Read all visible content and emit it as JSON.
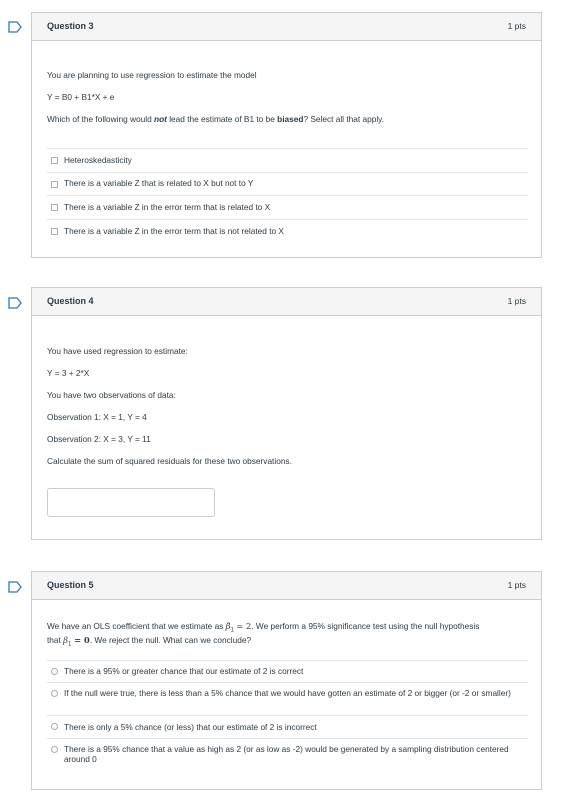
{
  "q3": {
    "title": "Question 3",
    "points": "1 pts",
    "intro": "You are planning to use regression to estimate the model",
    "model": "Y = B0 + B1*X + e",
    "prompt_a": "Which of the following would ",
    "prompt_not": "not",
    "prompt_b": " lead the estimate of B1 to be ",
    "prompt_biased": "biased",
    "prompt_c": "? Select all that apply.",
    "options": [
      "Heteroskedasticity",
      "There is a variable Z that is related to X but not to Y",
      "There is a variable Z in the error term that is related to X",
      "There is a variable Z in the error term that is not related to X"
    ]
  },
  "q4": {
    "title": "Question 4",
    "points": "1 pts",
    "line1": "You have used regression to estimate:",
    "line2": "Y = 3 + 2*X",
    "line3": "You have two observations of data:",
    "line4": "Observation 1: X = 1, Y = 4",
    "line5": "Observation 2: X = 3, Y = 11",
    "line6": "Calculate the sum of squared residuals for these two observations.",
    "answer_value": ""
  },
  "q5": {
    "title": "Question 5",
    "points": "1 pts",
    "line1a": "We have an OLS coefficient that we estimate as ",
    "beta_hat": "β̂",
    "sub1": "1",
    "eq_val": " = 2",
    "line1b": ". We perform a 95% significance test using the null hypothesis",
    "line2a": "that ",
    "beta": "β",
    "sub2": "1",
    "eq_zero": " = 0",
    "line2b": ". We reject the null. What can we conclude?",
    "options": [
      "There is a 95% or greater chance that our estimate of 2 is correct",
      "If the null were true, there is less than a 5% chance that we would have gotten an estimate of 2 or bigger (or -2 or smaller)",
      "There is only a 5% chance (or less) that our estimate of 2 is incorrect",
      "There is a 95% chance that a value as high as 2 (or as low as -2) would be generated by a sampling distribution centered around 0"
    ]
  },
  "colors": {
    "flag": "#2b7abc",
    "border": "#c7cdd1",
    "header_bg": "#f5f5f5"
  },
  "icons": {
    "flag": "flag-icon"
  }
}
